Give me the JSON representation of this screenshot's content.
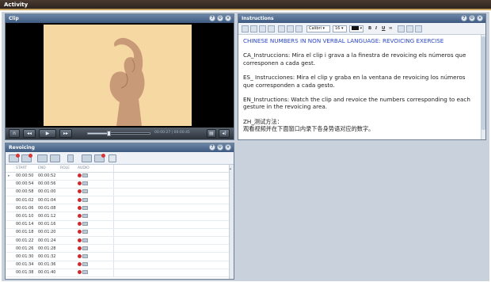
{
  "app": {
    "title": "Activity"
  },
  "clip": {
    "title": "Clip",
    "time": "00:00:27 | 00:00:45",
    "progress_fraction": 0.35
  },
  "instructions": {
    "title": "Instructions",
    "toolbar": {
      "font": "Calibri",
      "size": "16"
    },
    "heading": "CHINESE NUMBERS IN NON VERBAL LANGUAGE: REVOICING EXERCISE",
    "paragraphs": [
      "CA_Instruccions: Mira el clip i grava a la finestra de revoicing els números que corresponen a cada gest.",
      "ES_ Instrucciones: Mira el clip y graba en la ventana de revoicing los números que corresponden a cada gesto.",
      "EN_Instructions: Watch the clip and revoice the numbers corresponding to each gesture in the revoicing area.",
      "ZH_测试方法：\n观看视频并在下面窗口内录下各身势语对应的数字。"
    ]
  },
  "revoicing": {
    "title": "Revoicing",
    "columns": [
      "START",
      "END",
      "ROLE",
      "AUDIO"
    ],
    "rows": [
      {
        "start": "00:00:50",
        "end": "00:00:52"
      },
      {
        "start": "00:00:54",
        "end": "00:00:56"
      },
      {
        "start": "00:00:58",
        "end": "00:01:00"
      },
      {
        "start": "00:01:02",
        "end": "00:01:04"
      },
      {
        "start": "00:01:06",
        "end": "00:01:08"
      },
      {
        "start": "00:01:10",
        "end": "00:01:12"
      },
      {
        "start": "00:01:14",
        "end": "00:01:16"
      },
      {
        "start": "00:01:18",
        "end": "00:01:20"
      },
      {
        "start": "00:01:22",
        "end": "00:01:24"
      },
      {
        "start": "00:01:26",
        "end": "00:01:28"
      },
      {
        "start": "00:01:30",
        "end": "00:01:32"
      },
      {
        "start": "00:01:34",
        "end": "00:01:36"
      },
      {
        "start": "00:01:38",
        "end": "00:01:40"
      }
    ]
  },
  "colors": {
    "header": "#3f5a80",
    "title_text": "#2b47c4",
    "record": "#d02a2a",
    "video_bg": "#f6d9a3"
  }
}
